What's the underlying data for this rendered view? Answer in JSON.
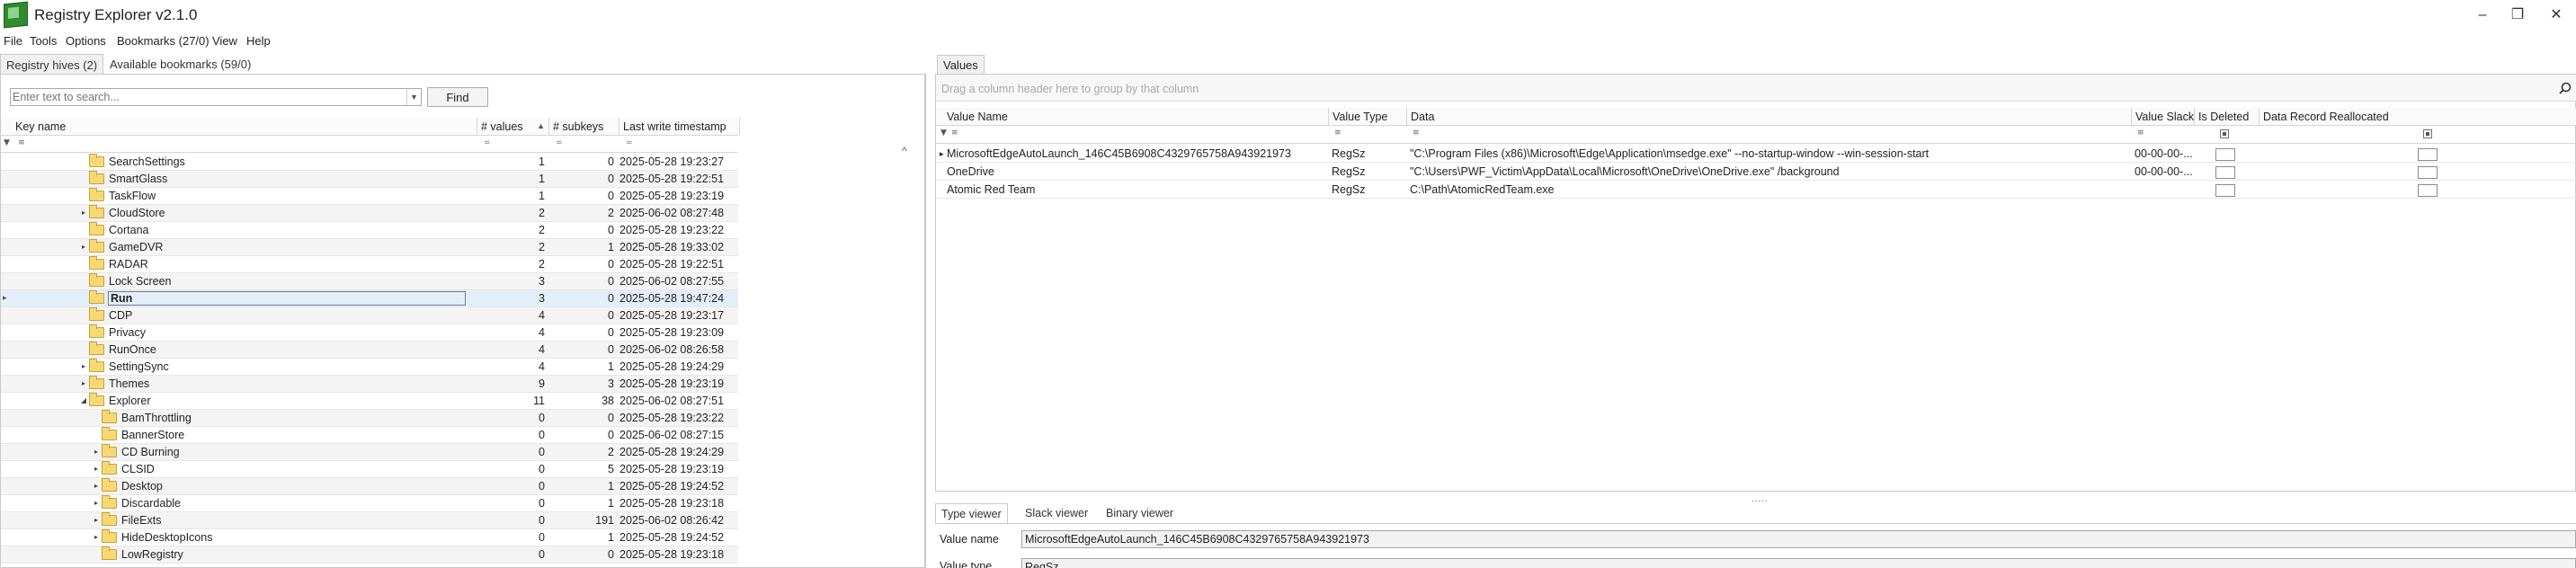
{
  "window": {
    "title": "Registry Explorer v2.1.0",
    "minimize": "–",
    "maximize": "❐",
    "close": "✕"
  },
  "menu": [
    "File",
    "Tools",
    "Options",
    "Bookmarks (27/0)",
    "View",
    "Help"
  ],
  "left_tabs": {
    "hives": "Registry hives (2)",
    "bookmarks": "Available bookmarks (59/0)"
  },
  "search": {
    "placeholder": "Enter text to search...",
    "find_label": "Find"
  },
  "tree_columns": {
    "key_name": "Key name",
    "values": "# values",
    "subkeys": "# subkeys",
    "timestamp": "Last write timestamp"
  },
  "tree_rows": [
    {
      "name": "SearchSettings",
      "values": "1",
      "subkeys": "0",
      "ts": "2025-05-28 19:23:27"
    },
    {
      "name": "SmartGlass",
      "values": "1",
      "subkeys": "0",
      "ts": "2025-05-28 19:22:51"
    },
    {
      "name": "TaskFlow",
      "values": "1",
      "subkeys": "0",
      "ts": "2025-05-28 19:23:19"
    },
    {
      "name": "CloudStore",
      "values": "2",
      "subkeys": "2",
      "ts": "2025-06-02 08:27:48"
    },
    {
      "name": "Cortana",
      "values": "2",
      "subkeys": "0",
      "ts": "2025-05-28 19:23:22"
    },
    {
      "name": "GameDVR",
      "values": "2",
      "subkeys": "1",
      "ts": "2025-05-28 19:33:02"
    },
    {
      "name": "RADAR",
      "values": "2",
      "subkeys": "0",
      "ts": "2025-05-28 19:22:51"
    },
    {
      "name": "Lock Screen",
      "values": "3",
      "subkeys": "0",
      "ts": "2025-06-02 08:27:55"
    },
    {
      "name": "Run",
      "values": "3",
      "subkeys": "0",
      "ts": "2025-05-28 19:47:24"
    },
    {
      "name": "CDP",
      "values": "4",
      "subkeys": "0",
      "ts": "2025-05-28 19:23:17"
    },
    {
      "name": "Privacy",
      "values": "4",
      "subkeys": "0",
      "ts": "2025-05-28 19:23:09"
    },
    {
      "name": "RunOnce",
      "values": "4",
      "subkeys": "0",
      "ts": "2025-06-02 08:26:58"
    },
    {
      "name": "SettingSync",
      "values": "4",
      "subkeys": "1",
      "ts": "2025-05-28 19:24:29"
    },
    {
      "name": "Themes",
      "values": "9",
      "subkeys": "3",
      "ts": "2025-05-28 19:23:19"
    },
    {
      "name": "Explorer",
      "values": "11",
      "subkeys": "38",
      "ts": "2025-06-02 08:27:51"
    },
    {
      "name": "BamThrottling",
      "values": "0",
      "subkeys": "0",
      "ts": "2025-05-28 19:23:22"
    },
    {
      "name": "BannerStore",
      "values": "0",
      "subkeys": "0",
      "ts": "2025-06-02 08:27:15"
    },
    {
      "name": "CD Burning",
      "values": "0",
      "subkeys": "2",
      "ts": "2025-05-28 19:24:29"
    },
    {
      "name": "CLSID",
      "values": "0",
      "subkeys": "5",
      "ts": "2025-05-28 19:23:19"
    },
    {
      "name": "Desktop",
      "values": "0",
      "subkeys": "1",
      "ts": "2025-05-28 19:24:52"
    },
    {
      "name": "Discardable",
      "values": "0",
      "subkeys": "1",
      "ts": "2025-05-28 19:23:18"
    },
    {
      "name": "FileExts",
      "values": "0",
      "subkeys": "191",
      "ts": "2025-06-02 08:26:42"
    },
    {
      "name": "HideDesktopIcons",
      "values": "0",
      "subkeys": "1",
      "ts": "2025-05-28 19:24:52"
    },
    {
      "name": "LowRegistry",
      "values": "0",
      "subkeys": "0",
      "ts": "2025-05-28 19:23:18"
    }
  ],
  "values_tab": "Values",
  "group_hint": "Drag a column header here to group by that column",
  "value_columns": {
    "name": "Value Name",
    "type": "Value Type",
    "data": "Data",
    "slack": "Value Slack",
    "deleted": "Is Deleted",
    "realloc": "Data Record Reallocated"
  },
  "value_rows": [
    {
      "name": "MicrosoftEdgeAutoLaunch_146C45B6908C4329765758A943921973",
      "type": "RegSz",
      "data": "\"C:\\Program Files (x86)\\Microsoft\\Edge\\Application\\msedge.exe\" --no-startup-window --win-session-start",
      "slack": "00-00-00-..."
    },
    {
      "name": "OneDrive",
      "type": "RegSz",
      "data": "\"C:\\Users\\PWF_Victim\\AppData\\Local\\Microsoft\\OneDrive\\OneDrive.exe\" /background",
      "slack": "00-00-00-..."
    },
    {
      "name": "Atomic Red Team",
      "type": "RegSz",
      "data": "C:\\Path\\AtomicRedTeam.exe",
      "slack": ""
    }
  ],
  "bottom_tabs": [
    "Type viewer",
    "Slack viewer",
    "Binary viewer"
  ],
  "type_viewer": {
    "value_name_label": "Value name",
    "value_name": "MicrosoftEdgeAutoLaunch_146C45B6908C4329765758A943921973",
    "value_type_label": "Value type",
    "value_type": "RegSz"
  },
  "icons": {
    "filter": "≡",
    "filter_funnel": "▼",
    "sort": "▲",
    "eq": "=",
    "scroll_up": "^",
    "expand": "▸",
    "collapse": "◢",
    "row_pointer": "▸",
    "splitter": "....."
  }
}
